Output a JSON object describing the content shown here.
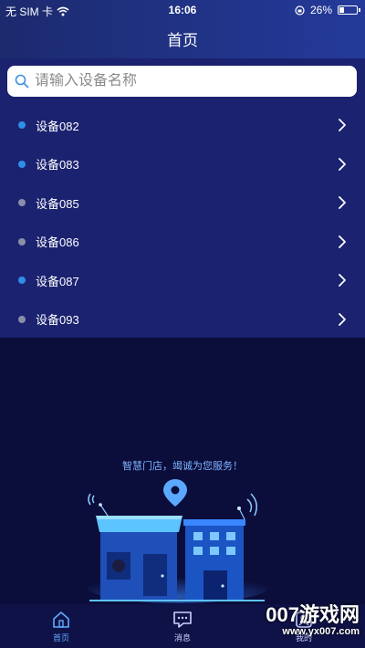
{
  "status_bar": {
    "carrier": "无 SIM 卡",
    "time": "16:06",
    "battery": "26%",
    "battery_level": 0.26
  },
  "header": {
    "title": "首页"
  },
  "search": {
    "placeholder": "请输入设备名称"
  },
  "devices": [
    {
      "name": "设备082",
      "status_color": "#2f8ee8"
    },
    {
      "name": "设备083",
      "status_color": "#2f8ee8"
    },
    {
      "name": "设备085",
      "status_color": "#8a8fa8"
    },
    {
      "name": "设备086",
      "status_color": "#8a8fa8"
    },
    {
      "name": "设备087",
      "status_color": "#2f8ee8"
    },
    {
      "name": "设备093",
      "status_color": "#8a8fa8"
    }
  ],
  "hero": {
    "slogan": "智慧门店，竭诚为您服务！"
  },
  "tabs": [
    {
      "label": "首页",
      "icon": "home-icon",
      "active": true
    },
    {
      "label": "消息",
      "icon": "message-icon",
      "active": false
    },
    {
      "label": "我的",
      "icon": "profile-icon",
      "active": false
    }
  ],
  "watermark": {
    "main": "007游戏网",
    "sub": "www.yx007.com"
  }
}
